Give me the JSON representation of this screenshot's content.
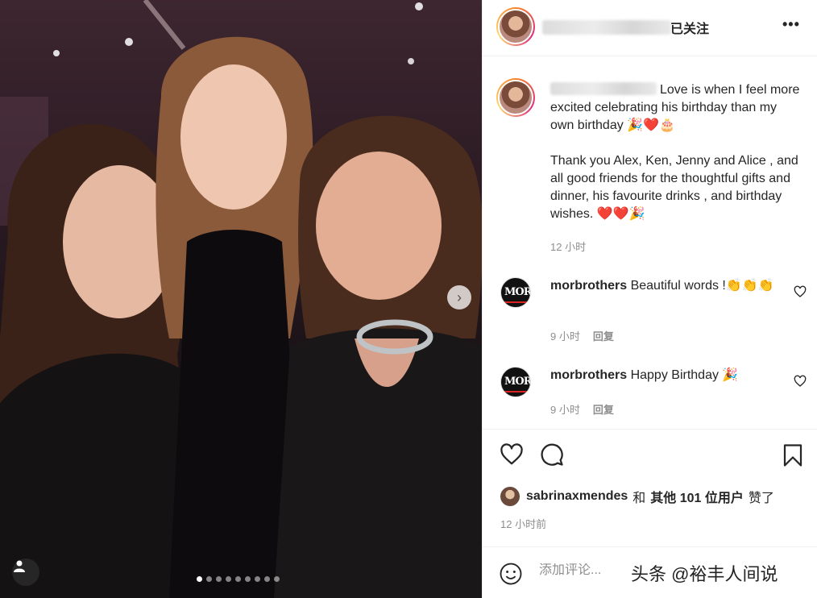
{
  "header": {
    "follow_status": "已关注",
    "more_label": "•••"
  },
  "caption": {
    "line1": "Love is when I feel more excited celebrating his birthday than my own birthday 🎉❤️🎂",
    "line2": "Thank you Alex, Ken, Jenny and Alice , and all good friends for the thoughtful gifts and dinner, his favourite drinks , and birthday wishes. ❤️❤️🎉",
    "time": "12 小时"
  },
  "comments": [
    {
      "user": "morbrothers",
      "text": "Beautiful words !👏👏👏",
      "time": "9 小时",
      "reply": "回复",
      "avatar_text": "MOR"
    },
    {
      "user": "morbrothers",
      "text": "Happy Birthday 🎉",
      "time": "9 小时",
      "reply": "回复",
      "avatar_text": "MOR"
    }
  ],
  "likes": {
    "user": "sabrinaxmendes",
    "connector": "和",
    "others": "其他 101 位用户",
    "suffix": "赞了"
  },
  "post_time": "12 小时前",
  "comment_input": {
    "placeholder": "添加评论..."
  },
  "watermark": "头条 @裕丰人间说",
  "carousel": {
    "total": 9,
    "active": 1
  },
  "icons": {
    "heart": "heart-icon",
    "comment": "comment-icon",
    "bookmark": "bookmark-icon",
    "emoji": "emoji-icon",
    "user_tag": "user-tag-icon",
    "next": "chevron-right-icon"
  },
  "colors": {
    "text": "#262626",
    "muted": "#8e8e8e",
    "ring_start": "#f58529",
    "ring_end": "#dd2a7b"
  }
}
